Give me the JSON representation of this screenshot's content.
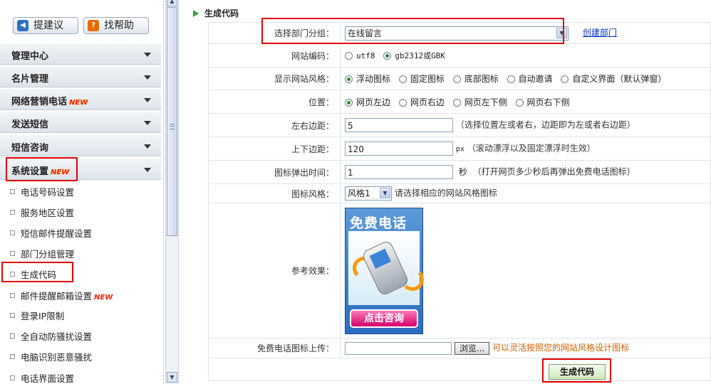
{
  "sidebar": {
    "suggest_label": "提建议",
    "help_label": "找帮助",
    "menus": [
      {
        "label": "管理中心"
      },
      {
        "label": "名片管理"
      },
      {
        "label": "网络营销电话",
        "badge": "NEW"
      },
      {
        "label": "发送短信"
      },
      {
        "label": "短信咨询"
      },
      {
        "label": "系统设置",
        "badge": "NEW"
      }
    ],
    "subitems": [
      {
        "label": "电话号码设置"
      },
      {
        "label": "服务地区设置"
      },
      {
        "label": "短信邮件提醒设置"
      },
      {
        "label": "部门分组管理"
      },
      {
        "label": "生成代码"
      },
      {
        "label": "邮件提醒邮箱设置",
        "badge": "NEW"
      },
      {
        "label": "登录IP限制"
      },
      {
        "label": "全自动防骚扰设置"
      },
      {
        "label": "电脑识别恶意骚扰"
      },
      {
        "label": "电话界面设置"
      }
    ]
  },
  "main": {
    "section_title": "生成代码",
    "dept": {
      "label": "选择部门分组：",
      "value": "在线留言",
      "create_link": "创建部门"
    },
    "encoding": {
      "label": "网站编码：",
      "options": [
        "utf8",
        "gb2312或GBK"
      ],
      "selected": 1
    },
    "style": {
      "label": "显示网站风格：",
      "options": [
        "浮动图标",
        "固定图标",
        "底部图标",
        "自动邀请",
        "自定义界面（默认弹窗）"
      ],
      "selected": 0
    },
    "position": {
      "label": "位置：",
      "options": [
        "网页左边",
        "网页右边",
        "网页左下侧",
        "网页右下侧"
      ],
      "selected": 0
    },
    "lr_margin": {
      "label": "左右边距：",
      "value": "5",
      "hint": "（选择位置左或者右，边距即为左或者右边距）"
    },
    "tb_margin": {
      "label": "上下边距：",
      "value": "120",
      "unit": "px",
      "hint": "（滚动漂浮以及固定漂浮时生效）"
    },
    "popup_time": {
      "label": "图标弹出时间：",
      "value": "1",
      "unit": "秒",
      "hint": "（打开网页多少秒后再弹出免费电话图标）"
    },
    "icon_style": {
      "label": "图标风格：",
      "value": "风格1",
      "hint": "请选择相应的网站风格图标"
    },
    "preview": {
      "label": "参考效果：",
      "title": "免费电话",
      "button": "点击咨询"
    },
    "upload": {
      "label": "免费电话图标上传：",
      "browse": "浏览...",
      "hint": "可以灵活按照您的网站风格设计图标"
    },
    "generate_button": "生成代码"
  }
}
